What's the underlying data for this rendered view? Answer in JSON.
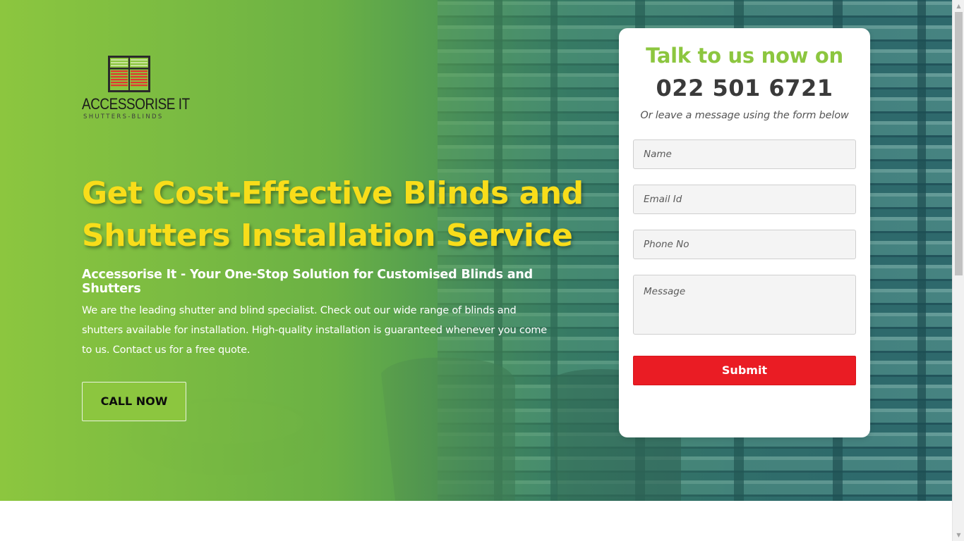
{
  "brand": {
    "name": "ACCESSORISE IT",
    "tagline": "SHUTTERS-BLINDS"
  },
  "hero": {
    "headline": "Get Cost-Effective Blinds and Shutters Installation Service",
    "subheadline": "Accessorise It - Your One-Stop Solution for Customised Blinds and Shutters",
    "intro": "We are the leading shutter and blind specialist. Check out our wide range of blinds and shutters available for installation. High-quality installation is guaranteed whenever you come to us. Contact us for a free quote.",
    "call_button": "CALL NOW"
  },
  "contact_form": {
    "title": "Talk to us now on",
    "phone": "022 501 6721",
    "note": "Or leave a message using the form below",
    "name_placeholder": "Name",
    "email_placeholder": "Email Id",
    "phone_placeholder": "Phone No",
    "message_placeholder": "Message",
    "submit_label": "Submit"
  },
  "colors": {
    "accent_green": "#8cc63f",
    "headline_yellow": "#f8dd1a",
    "submit_red": "#ea1c24",
    "overlay_teal": "#2c666c"
  },
  "scrollbar": {
    "up_icon": "arrow-up-icon",
    "down_icon": "arrow-down-icon"
  }
}
